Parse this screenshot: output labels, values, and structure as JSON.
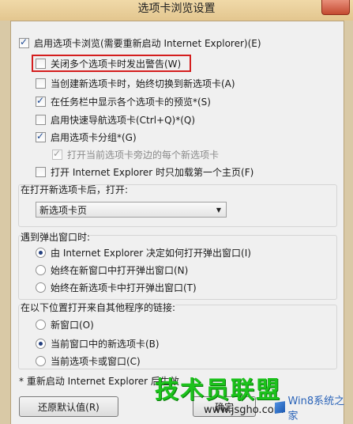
{
  "window": {
    "title": "选项卡浏览设置"
  },
  "options": {
    "enable_tabs": {
      "label": "启用选项卡浏览(需要重新启动 Internet Explorer)(E)",
      "checked": true
    },
    "warn_close": {
      "label": "关闭多个选项卡时发出警告(W)",
      "checked": false
    },
    "switch_new_tab": {
      "label": "当创建新选项卡时，始终切换到新选项卡(A)",
      "checked": false
    },
    "taskbar_preview": {
      "label": "在任务栏中显示各个选项卡的预览*(S)",
      "checked": true
    },
    "quick_tabs": {
      "label": "启用快速导航选项卡(Ctrl+Q)*(Q)",
      "checked": false
    },
    "tab_groups": {
      "label": "启用选项卡分组*(G)",
      "checked": true
    },
    "open_next": {
      "label": "打开当前选项卡旁边的每个新选项卡",
      "checked": true,
      "disabled": true
    },
    "first_home": {
      "label": "打开 Internet Explorer 时只加载第一个主页(F)",
      "checked": false
    }
  },
  "new_tab_group": {
    "label": "在打开新选项卡后，打开:",
    "selected": "新选项卡页"
  },
  "popup_group": {
    "label": "遇到弹出窗口时:",
    "options": [
      {
        "label": "由 Internet Explorer 决定如何打开弹出窗口(I)",
        "checked": true
      },
      {
        "label": "始终在新窗口中打开弹出窗口(N)",
        "checked": false
      },
      {
        "label": "始终在新选项卡中打开弹出窗口(T)",
        "checked": false
      }
    ]
  },
  "links_group": {
    "label": "在以下位置打开来自其他程序的链接:",
    "options": [
      {
        "label": "新窗口(O)",
        "checked": false
      },
      {
        "label": "当前窗口中的新选项卡(B)",
        "checked": true
      },
      {
        "label": "当前选项卡或窗口(C)",
        "checked": false
      }
    ]
  },
  "footer": {
    "note": "* 重新启动 Internet Explorer 后生效",
    "restore_label": "还原默认值(R)",
    "ok_label": "确定"
  },
  "watermark": {
    "brand": "技术员联盟",
    "url": "www.jsgho.com",
    "logo": "Win8系统之家"
  },
  "colors": {
    "highlight": "#d41e1e",
    "watermark": "#1cc21c"
  }
}
